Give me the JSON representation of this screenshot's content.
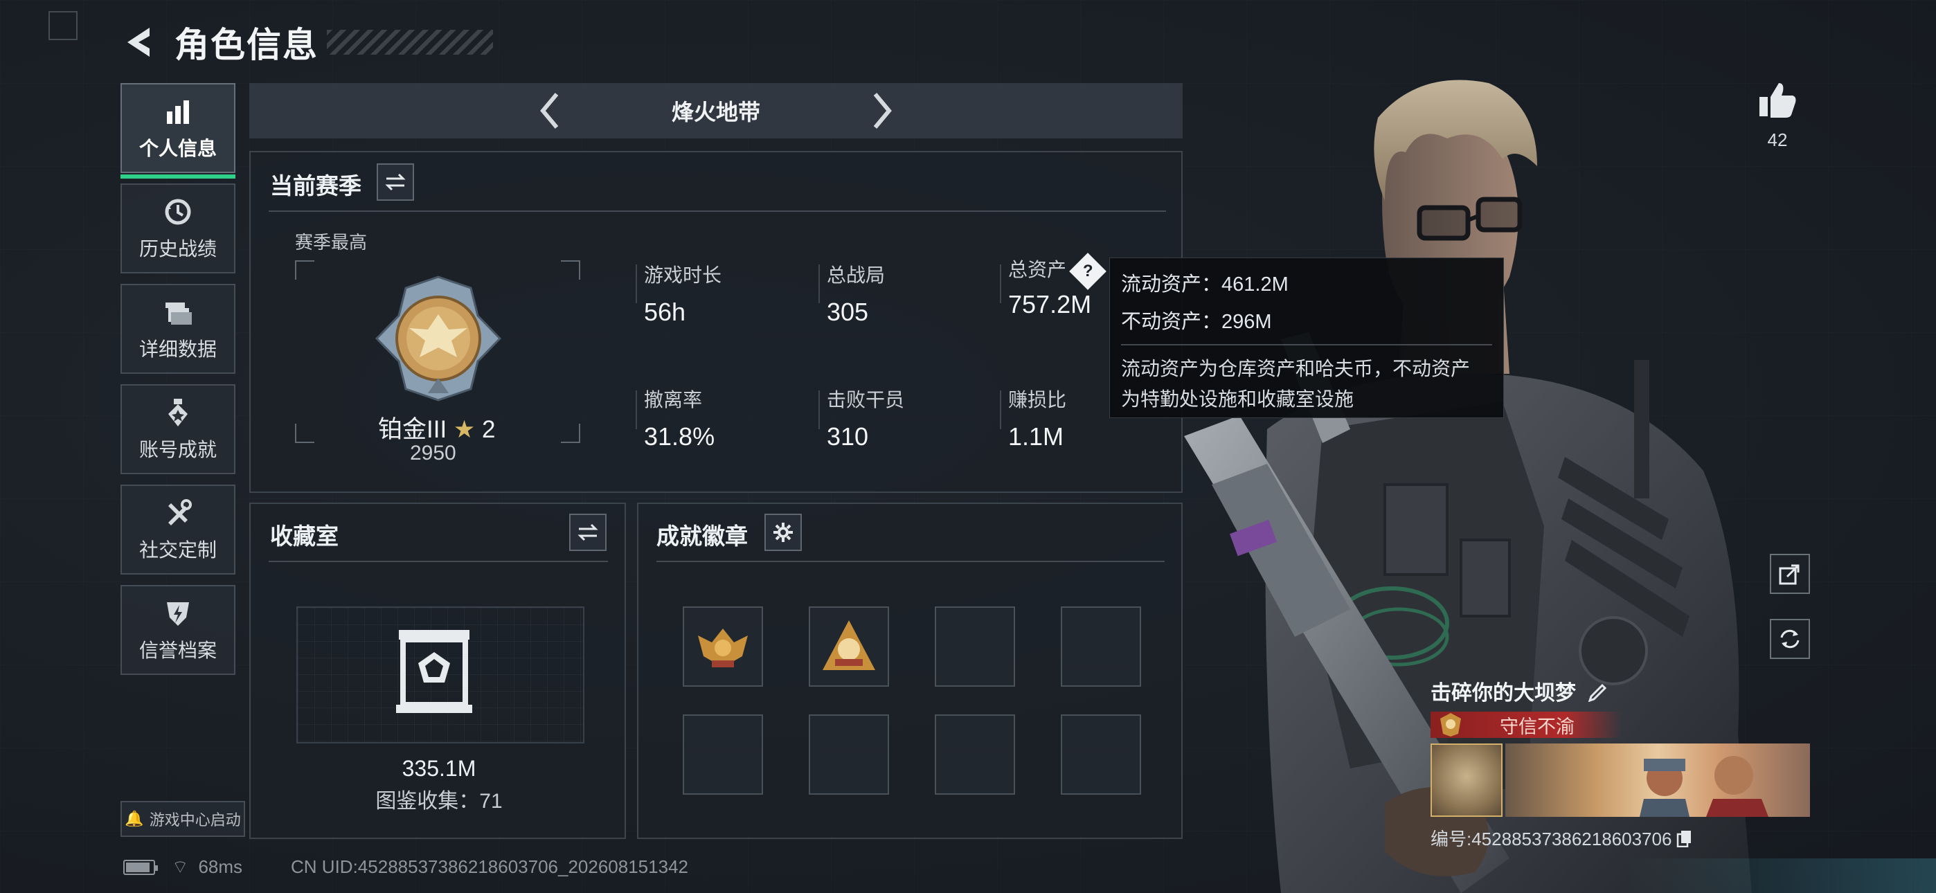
{
  "header": {
    "title": "角色信息"
  },
  "nav": {
    "items": [
      {
        "label": "个人信息",
        "icon": "bar-chart-icon",
        "active": true
      },
      {
        "label": "历史战绩",
        "icon": "history-icon",
        "active": false
      },
      {
        "label": "详细数据",
        "icon": "folder-icon",
        "active": false
      },
      {
        "label": "账号成就",
        "icon": "medal-icon",
        "active": false
      },
      {
        "label": "社交定制",
        "icon": "tools-icon",
        "active": false
      },
      {
        "label": "信誉档案",
        "icon": "shield-icon",
        "active": false
      }
    ],
    "launch_label": "游戏中心启动"
  },
  "status_bar": {
    "ping": "68ms",
    "uid": "CN UID:4528853738621860370​6_202608151342"
  },
  "mode": {
    "title": "烽火地带"
  },
  "season": {
    "title": "当前赛季",
    "best_label": "赛季最高",
    "rank_name": "铂金III",
    "rank_stars": "2",
    "rank_score": "2950",
    "stats": [
      {
        "label": "游戏时长",
        "value": "56h"
      },
      {
        "label": "总战局",
        "value": "305"
      },
      {
        "label": "总资产",
        "value": "757.2M"
      },
      {
        "label": "撤离率",
        "value": "31.8%"
      },
      {
        "label": "击败干员",
        "value": "310"
      },
      {
        "label": "赚损比",
        "value": "1.1M"
      }
    ]
  },
  "tooltip": {
    "liquid": "流动资产：461.2M",
    "fixed": "不动资产：296M",
    "desc_line1": "流动资产为仓库资产和哈夫币，不动资产",
    "desc_line2": "为特勤处设施和收藏室设施"
  },
  "collection": {
    "title": "收藏室",
    "value": "335.1M",
    "count": "图鉴收集：71"
  },
  "badges": {
    "title": "成就徽章"
  },
  "social": {
    "likes": "42"
  },
  "player": {
    "name": "击碎你的大坝梦",
    "title_tag": "守信不渝",
    "id": "编号:4528853738621860370​6"
  },
  "colors": {
    "accent": "#2fd08a",
    "banner_red": "#b02a2a",
    "gold": "#d8b865"
  }
}
